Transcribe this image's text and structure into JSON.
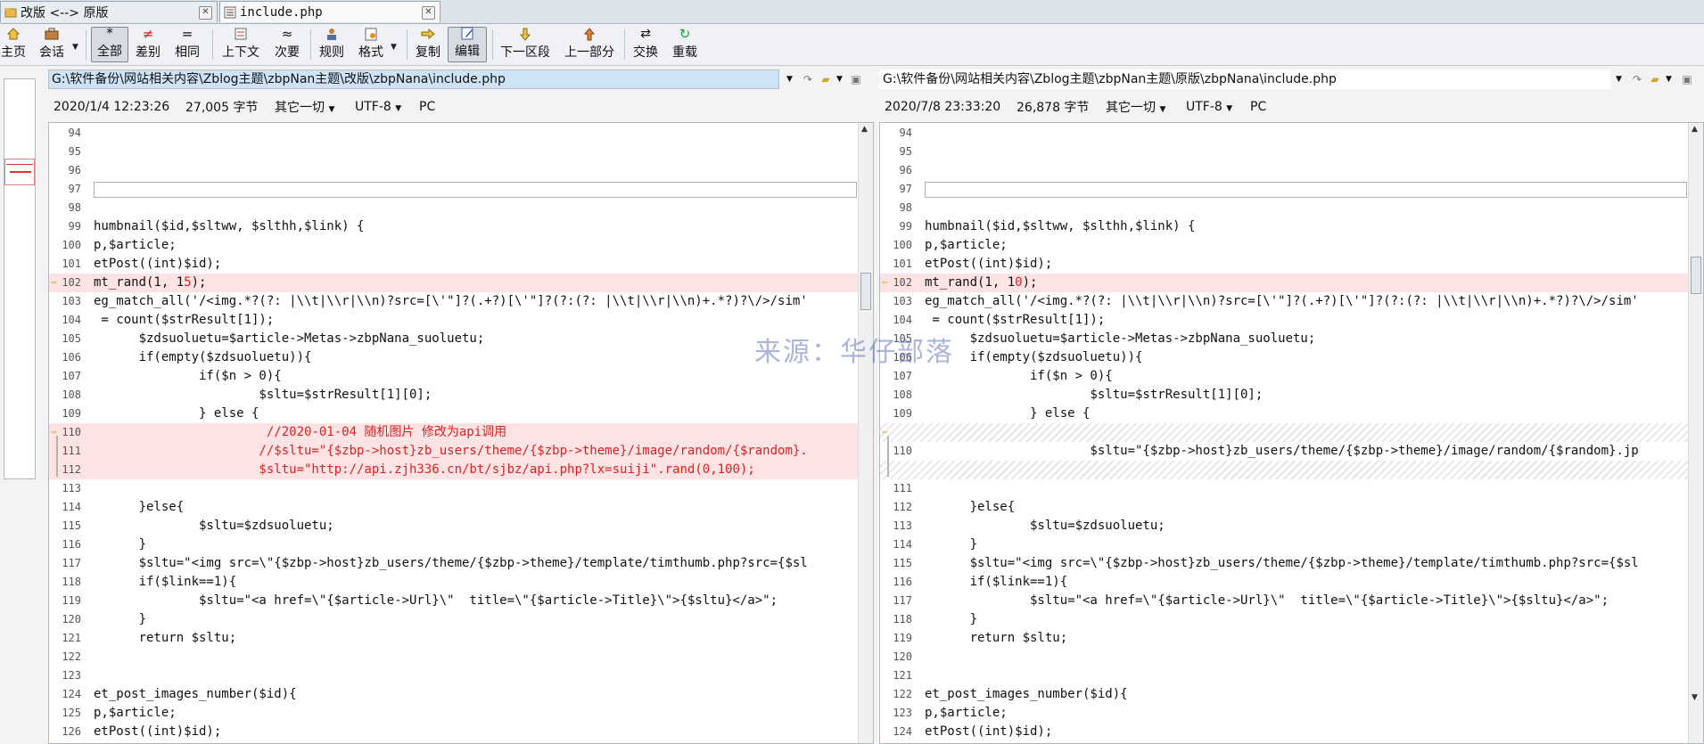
{
  "tabs": [
    {
      "label": "改版 <--> 原版"
    },
    {
      "label": "include.php"
    }
  ],
  "toolbar": {
    "home": "主页",
    "session": "会话",
    "all": "全部",
    "diffs": "差别",
    "same": "相同",
    "context": "上下文",
    "minor": "次要",
    "rules": "规则",
    "format": "格式",
    "copy": "复制",
    "edit": "编辑",
    "next_section": "下一区段",
    "prev_section": "上一部分",
    "swap": "交换",
    "reload": "重载"
  },
  "left": {
    "path": "G:\\软件备份\\网站相关内容\\Zblog主题\\zbpNan主题\\改版\\zbpNana\\include.php",
    "date": "2020/1/4 12:23:26",
    "size": "27,005 字节",
    "other": "其它一切",
    "encoding": "UTF-8",
    "lineend": "PC"
  },
  "right": {
    "path": "G:\\软件备份\\网站相关内容\\Zblog主题\\zbpNan主题\\原版\\zbpNana\\include.php",
    "date": "2020/7/8 23:33:20",
    "size": "26,878 字节",
    "other": "其它一切",
    "encoding": "UTF-8",
    "lineend": "PC"
  },
  "watermark": "来源：华仔部落",
  "left_lines": [
    {
      "n": "94",
      "t": ""
    },
    {
      "n": "95",
      "t": ""
    },
    {
      "n": "96",
      "t": ""
    },
    {
      "n": "97",
      "t": "",
      "box": true
    },
    {
      "n": "98",
      "t": ""
    },
    {
      "n": "99",
      "t": "humbnail($id,$sltww, $slthh,$link) {"
    },
    {
      "n": "100",
      "t": "p,$article;"
    },
    {
      "n": "101",
      "t": "etPost((int)$id);"
    },
    {
      "n": "102",
      "t": "mt_rand(1, 1",
      "red": "5",
      "after": ");",
      "diff": true,
      "mark": true
    },
    {
      "n": "103",
      "t": "eg_match_all('/<img.*?(?: |\\\\t|\\\\r|\\\\n)?src=[\\'\"]?(.+?)[\\'\"]?(?:(?: |\\\\t|\\\\r|\\\\n)+.*?)?\\/>/sim'"
    },
    {
      "n": "104",
      "t": " = count($strResult[1]);"
    },
    {
      "n": "105",
      "t": "      $zdsuoluetu=$article->Metas->zbpNana_suoluetu;"
    },
    {
      "n": "106",
      "t": "      if(empty($zdsuoluetu)){"
    },
    {
      "n": "107",
      "t": "              if($n > 0){"
    },
    {
      "n": "108",
      "t": "                      $sltu=$strResult[1][0];"
    },
    {
      "n": "109",
      "t": "              } else {"
    },
    {
      "n": "110",
      "t": "",
      "red": "                       //2020-01-04 随机图片 修改为api调用",
      "diff": true,
      "mark": true
    },
    {
      "n": "111",
      "t": "",
      "red": "                      //$sltu=\"{$zbp->host}zb_users/theme/{$zbp->theme}/image/random/{$random}.",
      "diff": true
    },
    {
      "n": "112",
      "t": "",
      "red": "                      $sltu=\"http://api.zjh336.cn/bt/sjbz/api.php?lx=suiji\".rand(0,100);",
      "diff": true
    },
    {
      "n": "113",
      "t": ""
    },
    {
      "n": "114",
      "t": "      }else{"
    },
    {
      "n": "115",
      "t": "              $sltu=$zdsuoluetu;"
    },
    {
      "n": "116",
      "t": "      }"
    },
    {
      "n": "117",
      "t": "      $sltu=\"<img src=\\\"{$zbp->host}zb_users/theme/{$zbp->theme}/template/timthumb.php?src={$sl"
    },
    {
      "n": "118",
      "t": "      if($link==1){"
    },
    {
      "n": "119",
      "t": "              $sltu=\"<a href=\\\"{$article->Url}\\\"  title=\\\"{$article->Title}\\\">{$sltu}</a>\";"
    },
    {
      "n": "120",
      "t": "      }"
    },
    {
      "n": "121",
      "t": "      return $sltu;"
    },
    {
      "n": "122",
      "t": ""
    },
    {
      "n": "123",
      "t": ""
    },
    {
      "n": "124",
      "t": "et_post_images_number($id){"
    },
    {
      "n": "125",
      "t": "p,$article;"
    },
    {
      "n": "126",
      "t": "etPost((int)$id);"
    }
  ],
  "right_lines": [
    {
      "n": "94",
      "t": ""
    },
    {
      "n": "95",
      "t": ""
    },
    {
      "n": "96",
      "t": ""
    },
    {
      "n": "97",
      "t": "",
      "box": true
    },
    {
      "n": "98",
      "t": ""
    },
    {
      "n": "99",
      "t": "humbnail($id,$sltww, $slthh,$link) {"
    },
    {
      "n": "100",
      "t": "p,$article;"
    },
    {
      "n": "101",
      "t": "etPost((int)$id);"
    },
    {
      "n": "102",
      "t": "mt_rand(1, 1",
      "red": "0",
      "after": ");",
      "diff": true,
      "mark": true
    },
    {
      "n": "103",
      "t": "eg_match_all('/<img.*?(?: |\\\\t|\\\\r|\\\\n)?src=[\\'\"]?(.+?)[\\'\"]?(?:(?: |\\\\t|\\\\r|\\\\n)+.*?)?\\/>/sim'"
    },
    {
      "n": "104",
      "t": " = count($strResult[1]);"
    },
    {
      "n": "105",
      "t": "      $zdsuoluetu=$article->Metas->zbpNana_suoluetu;"
    },
    {
      "n": "106",
      "t": "      if(empty($zdsuoluetu)){"
    },
    {
      "n": "107",
      "t": "              if($n > 0){"
    },
    {
      "n": "108",
      "t": "                      $sltu=$strResult[1][0];"
    },
    {
      "n": "109",
      "t": "              } else {"
    },
    {
      "n": "",
      "t": "",
      "hatch": true,
      "mark": true
    },
    {
      "n": "110",
      "t": "                      $sltu=\"{$zbp->host}zb_users/theme/{$zbp->theme}/image/random/{$random}.jp"
    },
    {
      "n": "",
      "t": "",
      "hatch": true
    },
    {
      "n": "111",
      "t": ""
    },
    {
      "n": "112",
      "t": "      }else{"
    },
    {
      "n": "113",
      "t": "              $sltu=$zdsuoluetu;"
    },
    {
      "n": "114",
      "t": "      }"
    },
    {
      "n": "115",
      "t": "      $sltu=\"<img src=\\\"{$zbp->host}zb_users/theme/{$zbp->theme}/template/timthumb.php?src={$sl"
    },
    {
      "n": "116",
      "t": "      if($link==1){"
    },
    {
      "n": "117",
      "t": "              $sltu=\"<a href=\\\"{$article->Url}\\\"  title=\\\"{$article->Title}\\\">{$sltu}</a>\";"
    },
    {
      "n": "118",
      "t": "      }"
    },
    {
      "n": "119",
      "t": "      return $sltu;"
    },
    {
      "n": "120",
      "t": ""
    },
    {
      "n": "121",
      "t": ""
    },
    {
      "n": "122",
      "t": "et_post_images_number($id){"
    },
    {
      "n": "123",
      "t": "p,$article;"
    },
    {
      "n": "124",
      "t": "etPost((int)$id);"
    }
  ]
}
